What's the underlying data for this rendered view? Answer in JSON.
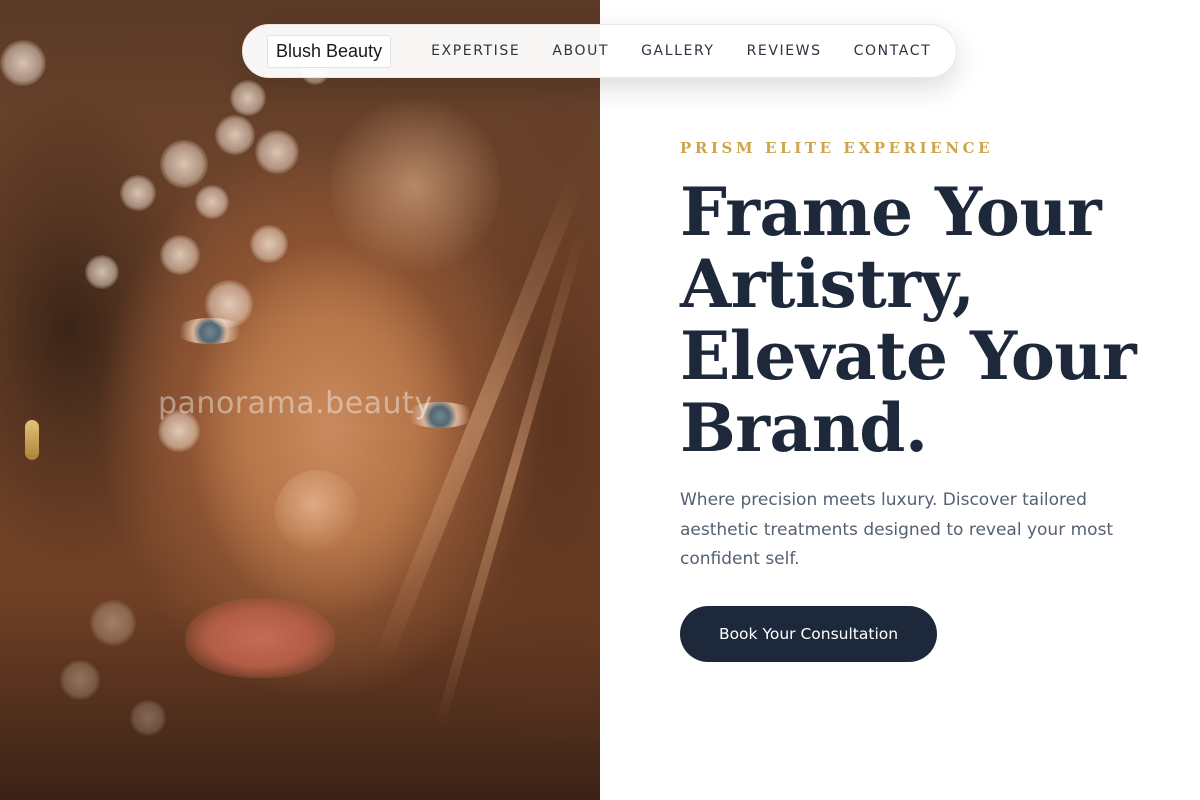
{
  "hero_image": {
    "watermark": "panorama.beauty"
  },
  "nav": {
    "logo": "Blush Beauty",
    "links": [
      "EXPERTISE",
      "ABOUT",
      "GALLERY",
      "REVIEWS",
      "CONTACT"
    ]
  },
  "hero": {
    "eyebrow": "PRISM ELITE EXPERIENCE",
    "headline_lines": [
      "Frame Your",
      "Artistry,",
      "Elevate Your",
      "Brand."
    ],
    "subtext": "Where precision meets luxury. Discover tailored aesthetic treatments designed to reveal your most confident self.",
    "cta_label": "Book Your Consultation"
  },
  "colors": {
    "accent_gold": "#cda64a",
    "navy": "#1e283b",
    "body_text": "#556170"
  }
}
